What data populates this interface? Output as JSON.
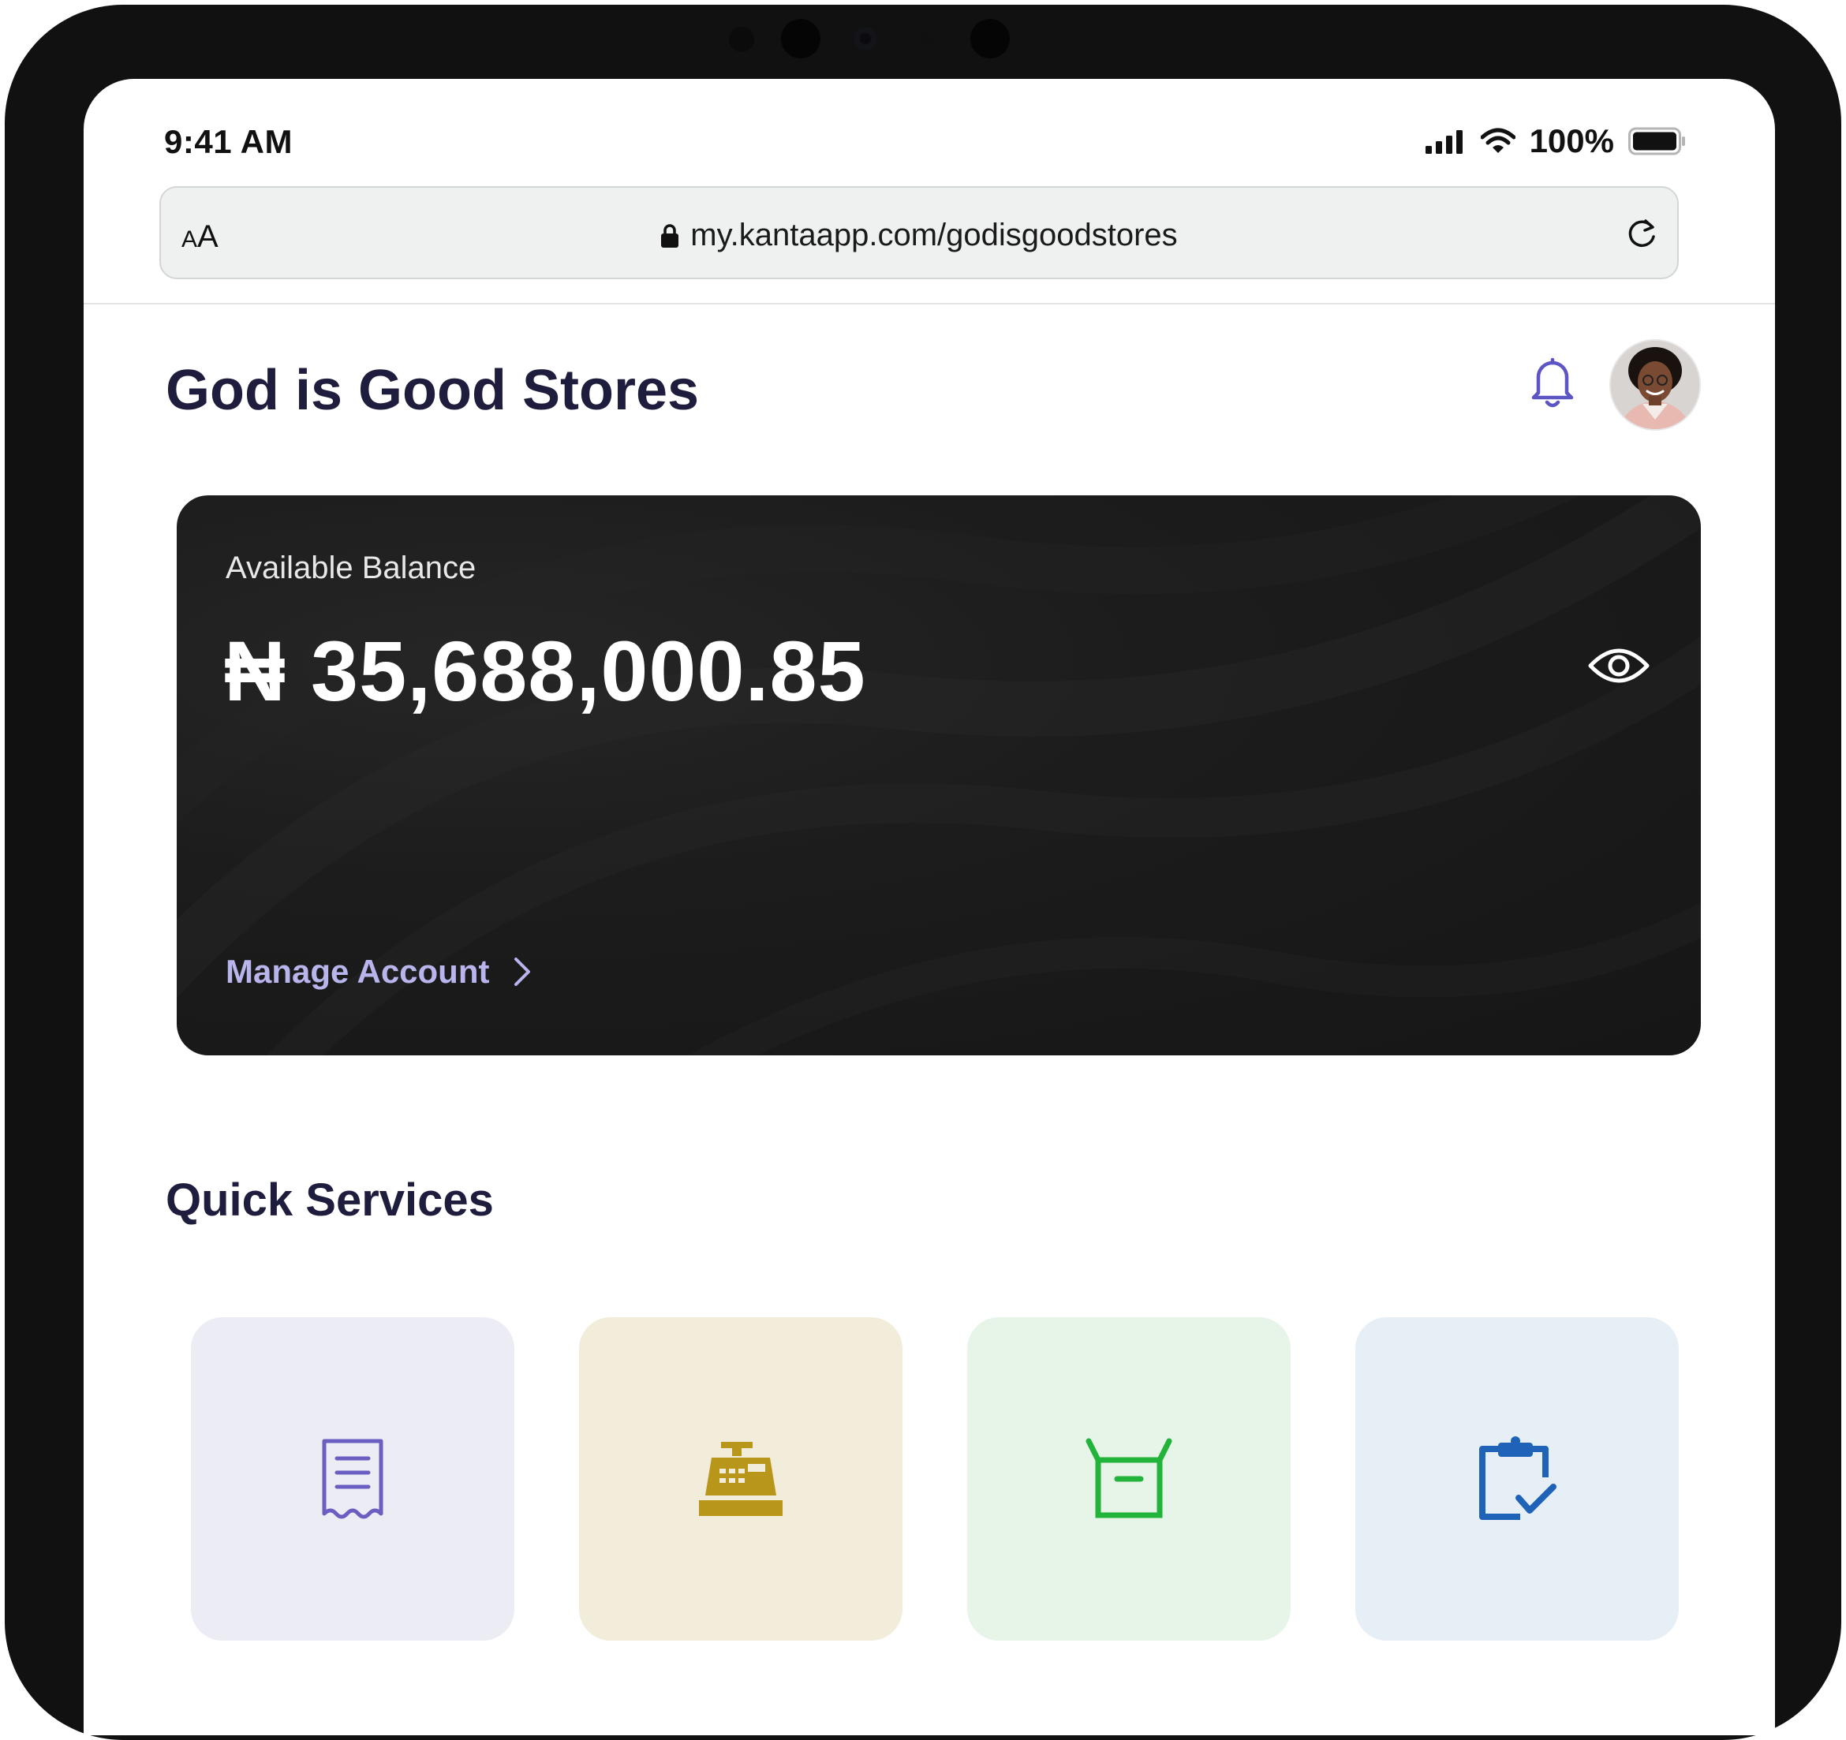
{
  "status_bar": {
    "time": "9:41 AM",
    "battery": "100%"
  },
  "browser": {
    "text_size_small": "A",
    "text_size_big": "A",
    "url": "my.kantaapp.com/godisgoodstores"
  },
  "header": {
    "store_name": "God is Good Stores"
  },
  "balance_card": {
    "label": "Available Balance",
    "amount": "₦ 35,688,000.85",
    "manage_label": "Manage Account"
  },
  "quick_services": {
    "title": "Quick Services",
    "tiles": [
      {
        "icon": "receipt-icon",
        "color": "#6a5fc1",
        "bg": "#ececf5"
      },
      {
        "icon": "cash-register-icon",
        "color": "#b8961a",
        "bg": "#f2ecdb"
      },
      {
        "icon": "box-icon",
        "color": "#22b33a",
        "bg": "#e6f5e7"
      },
      {
        "icon": "clipboard-check-icon",
        "color": "#1f63b8",
        "bg": "#e6eef6"
      }
    ]
  },
  "colors": {
    "title": "#1f1d3d",
    "accent": "#5e55c4",
    "manage_link": "#b8b4ec",
    "card_bg": "#1c1c1c"
  }
}
